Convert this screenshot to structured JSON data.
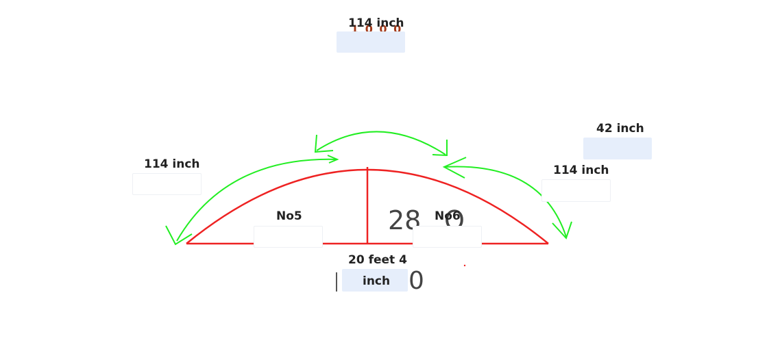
{
  "labels": {
    "top": "114 inch",
    "top_right": "42 inch",
    "left": "114 inch",
    "right": "114 inch",
    "no5": "No5",
    "no6": "No6",
    "bottom_line1": "20 feet 4",
    "bottom_line2": "inch"
  },
  "handwriting": {
    "top_scribble": "1 0 0 0",
    "center_value": "28",
    "bottom_value": "0"
  },
  "colors": {
    "arch": "#ee2222",
    "arrows": "#22ee22",
    "box_fill": "#e6eefb",
    "scribble": "#a33a1a"
  }
}
